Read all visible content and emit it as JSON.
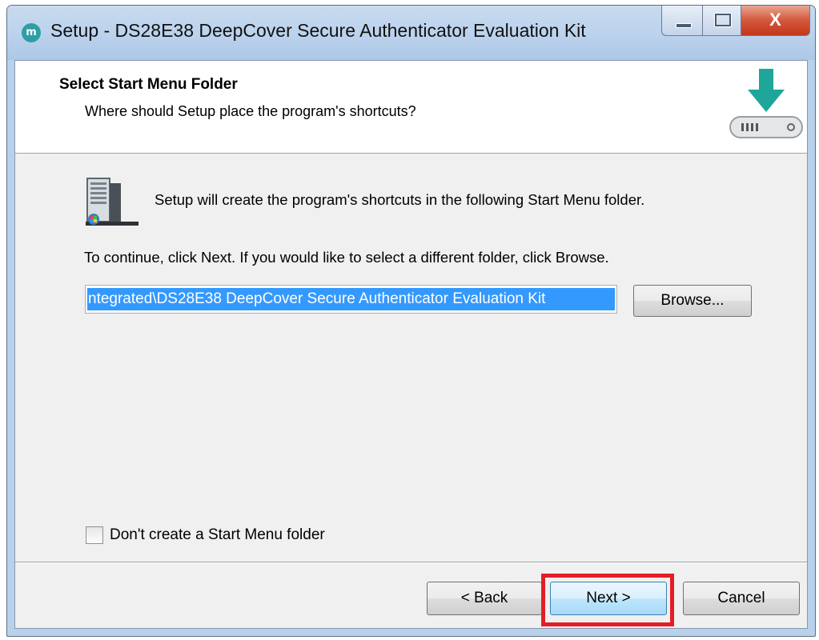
{
  "window": {
    "title": "Setup - DS28E38 DeepCover Secure Authenticator Evaluation Kit",
    "icon": "maxim-logo-icon",
    "close_label": "X"
  },
  "header": {
    "title": "Select Start Menu Folder",
    "subtitle": "Where should Setup place the program's shortcuts?"
  },
  "body": {
    "info_text": "Setup will create the program's shortcuts in the following Start Menu folder.",
    "continue_text": "To continue, click Next. If you would like to select a different folder, click Browse.",
    "folder_value": "ntegrated\\DS28E38 DeepCover Secure Authenticator Evaluation Kit",
    "browse_label": "Browse...",
    "checkbox_label": "Don't create a Start Menu folder",
    "checkbox_checked": false
  },
  "footer": {
    "back_label": "< Back",
    "next_label": "Next >",
    "cancel_label": "Cancel"
  },
  "colors": {
    "accent": "#2e9ea6",
    "highlight": "#e51d26",
    "selection": "#3399ff"
  }
}
